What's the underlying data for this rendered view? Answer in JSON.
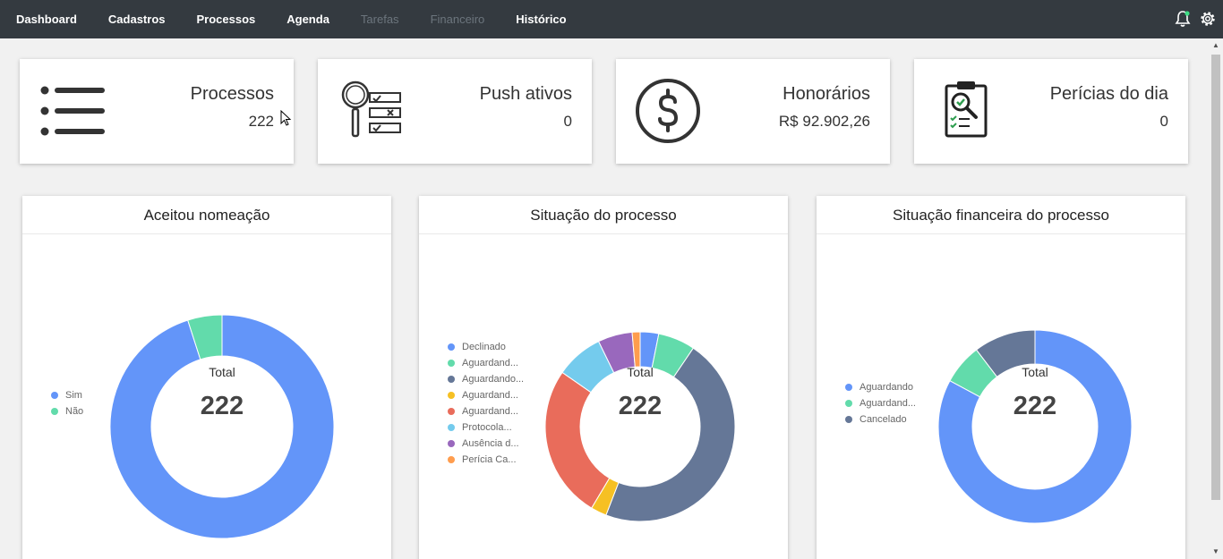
{
  "nav": {
    "items": [
      {
        "label": "Dashboard",
        "enabled": true
      },
      {
        "label": "Cadastros",
        "enabled": true
      },
      {
        "label": "Processos",
        "enabled": true
      },
      {
        "label": "Agenda",
        "enabled": true
      },
      {
        "label": "Tarefas",
        "enabled": false
      },
      {
        "label": "Financeiro",
        "enabled": false
      },
      {
        "label": "Histórico",
        "enabled": true
      }
    ],
    "icons": [
      "bell-icon",
      "gear-icon"
    ]
  },
  "stats": [
    {
      "title": "Processos",
      "value": "222",
      "icon": "list-icon"
    },
    {
      "title": "Push ativos",
      "value": "0",
      "icon": "search-checklist-icon"
    },
    {
      "title": "Honorários",
      "value": "R$ 92.902,26",
      "icon": "dollar-icon"
    },
    {
      "title": "Perícias do dia",
      "value": "0",
      "icon": "clipboard-search-icon"
    }
  ],
  "charts": [
    {
      "title": "Aceitou nomeação",
      "center_title": "Total",
      "center_value": "222"
    },
    {
      "title": "Situação do processo",
      "center_title": "Total",
      "center_value": "222"
    },
    {
      "title": "Situação financeira do processo",
      "center_title": "Total",
      "center_value": "222"
    }
  ],
  "chart_data": [
    {
      "type": "pie",
      "title": "Aceitou nomeação",
      "categories": [
        "Sim",
        "Não"
      ],
      "values": [
        211,
        11
      ],
      "colors": [
        "#6395f9",
        "#62dbab"
      ],
      "legend": "left"
    },
    {
      "type": "pie",
      "title": "Situação do processo",
      "categories": [
        "Declinado",
        "Aguardand...",
        "Aguardando...",
        "Aguardand...",
        "Aguardand...",
        "Protocola...",
        "Ausência d...",
        "Perícia Ca..."
      ],
      "values": [
        7,
        14,
        103,
        6,
        58,
        18,
        13,
        3
      ],
      "colors": [
        "#6395f9",
        "#62dbab",
        "#657797",
        "#f6c023",
        "#e96c5b",
        "#74cbed",
        "#9968bd",
        "#ff9d4e"
      ],
      "legend": "left"
    },
    {
      "type": "pie",
      "title": "Situação financeira do processo",
      "categories": [
        "Aguardando",
        "Aguardand...",
        "Cancelado"
      ],
      "values": [
        184,
        15,
        23
      ],
      "colors": [
        "#6395f9",
        "#62dbab",
        "#657797"
      ],
      "legend": "left"
    }
  ]
}
